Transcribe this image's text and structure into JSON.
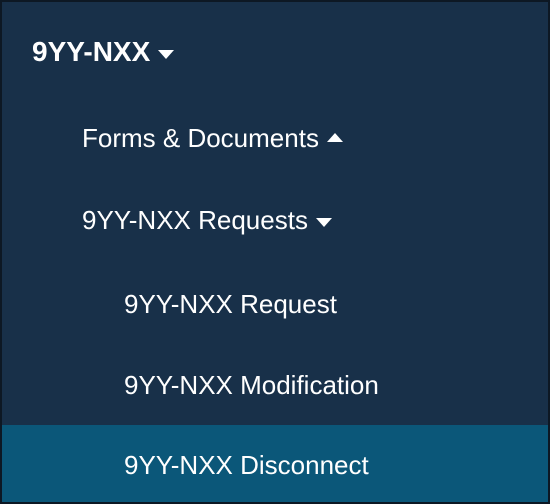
{
  "nav": {
    "top": {
      "label": "9YY-NXX",
      "caret": "caret-down-icon"
    },
    "forms": {
      "label": "Forms & Documents",
      "caret": "caret-up-icon"
    },
    "requests": {
      "label": "9YY-NXX Requests",
      "caret": "caret-down-icon"
    },
    "items": [
      {
        "label": "9YY-NXX Request"
      },
      {
        "label": "9YY-NXX Modification"
      },
      {
        "label": "9YY-NXX Disconnect",
        "active": true
      }
    ]
  },
  "colors": {
    "panel_bg": "#183049",
    "active_bg": "#0b5779",
    "text": "#ffffff",
    "border": "#0d1824"
  }
}
